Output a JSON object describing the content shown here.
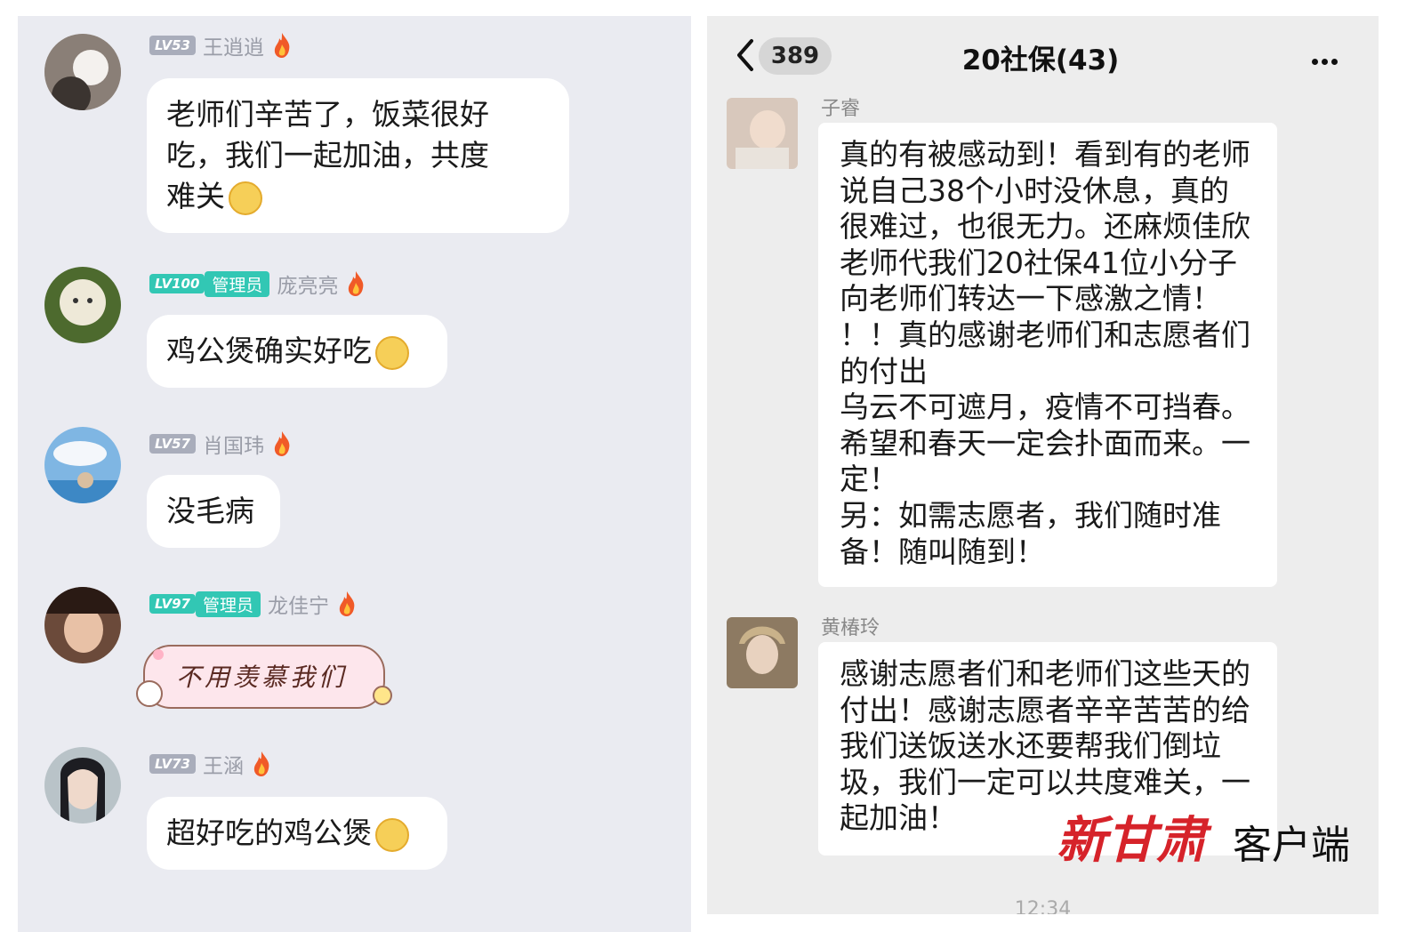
{
  "left_chat": {
    "messages": [
      {
        "level": "LV53",
        "role": "",
        "name": "王逍逍",
        "text": "老师们辛苦了，饭菜很好\n吃，我们一起加油，共度\n难关"
      },
      {
        "level": "LV100",
        "role": "管理员",
        "name": "庞亮亮",
        "text": "鸡公煲确实好吃"
      },
      {
        "level": "LV57",
        "role": "",
        "name": "肖国玮",
        "text": "没毛病"
      },
      {
        "level": "LV97",
        "role": "管理员",
        "name": "龙佳宁",
        "sticker_text": "不用羡慕我们"
      },
      {
        "level": "LV73",
        "role": "",
        "name": "王涵",
        "text": "超好吃的鸡公煲"
      }
    ]
  },
  "right_chat": {
    "header": {
      "back_count": "389",
      "title": "20社保(43)"
    },
    "messages": [
      {
        "name": "子睿",
        "text": "真的有被感动到！看到有的老师\n说自己38个小时没休息，真的\n很难过，也很无力。还麻烦佳欣\n老师代我们20社保41位小分子\n向老师们转达一下感激之情！\n！！真的感谢老师们和志愿者们\n的付出\n乌云不可遮月，疫情不可挡春。\n希望和春天一定会扑面而来。一\n定！\n另：如需志愿者，我们随时准\n备！随叫随到！"
      },
      {
        "name": "黄椿玲",
        "text": "感谢志愿者们和老师们这些天的\n付出！感谢志愿者辛辛苦苦的给\n我们送饭送水还要帮我们倒垃\n圾，我们一定可以共度难关，一\n起加油！"
      }
    ],
    "timestamp": "12:34"
  },
  "watermark": {
    "brand": "新甘肃",
    "suffix": "客户端"
  }
}
